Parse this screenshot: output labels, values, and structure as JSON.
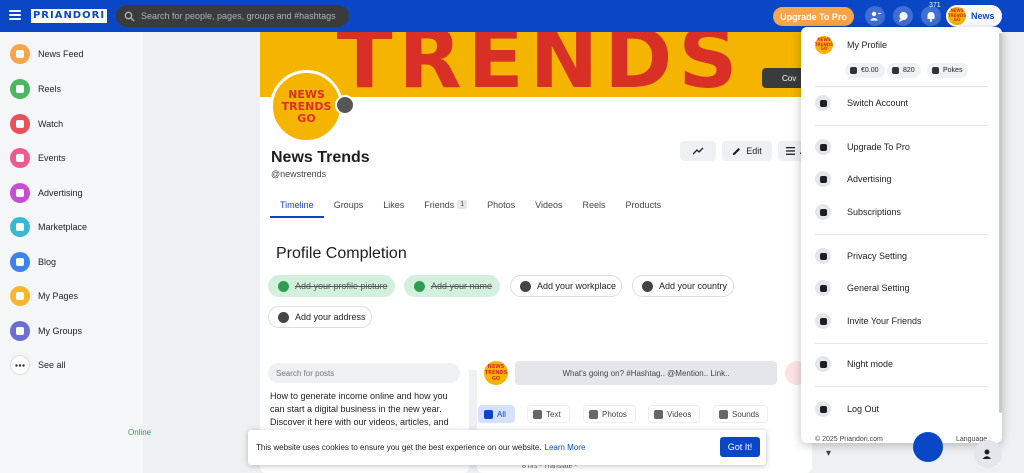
{
  "topbar": {
    "logo_text": "PRIANDORI",
    "search_placeholder": "Search for people, pages, groups and #hashtags",
    "upgrade_label": "Upgrade To Pro",
    "notification_count": "371",
    "user_name": "News"
  },
  "sidebar": {
    "items": [
      {
        "label": "News Feed",
        "color": "#f7a54b"
      },
      {
        "label": "Reels",
        "color": "#4cb663"
      },
      {
        "label": "Watch",
        "color": "#e8505b"
      },
      {
        "label": "Events",
        "color": "#ee5b8c"
      },
      {
        "label": "Advertising",
        "color": "#c44fd4"
      },
      {
        "label": "Marketplace",
        "color": "#37b9d4"
      },
      {
        "label": "Blog",
        "color": "#3c82e8"
      },
      {
        "label": "My Pages",
        "color": "#f7b42c"
      },
      {
        "label": "My Groups",
        "color": "#6b6fd4"
      },
      {
        "label": "See all",
        "color": "#ffffff"
      }
    ]
  },
  "cover": {
    "title_text": "TRENDS",
    "button_label": "Cov"
  },
  "profile": {
    "avatar_line1": "NEWS",
    "avatar_line2": "TRENDS",
    "avatar_line3": "GO",
    "name": "News Trends",
    "handle": "@newstrends",
    "edit_label": "Edit",
    "more_label": "A",
    "tabs": [
      {
        "label": "Timeline"
      },
      {
        "label": "Groups"
      },
      {
        "label": "Likes"
      },
      {
        "label": "Friends",
        "count": "1"
      },
      {
        "label": "Photos"
      },
      {
        "label": "Videos"
      },
      {
        "label": "Reels"
      },
      {
        "label": "Products"
      }
    ]
  },
  "completion": {
    "title": "Profile Completion",
    "items": [
      {
        "label": "Add your profile picture",
        "done": true
      },
      {
        "label": "Add your name",
        "done": true
      },
      {
        "label": "Add your workplace",
        "done": false
      },
      {
        "label": "Add your country",
        "done": false
      },
      {
        "label": "Add your address",
        "done": false
      }
    ]
  },
  "left_card": {
    "search_placeholder": "Search for posts",
    "text": "How to generate income online and how you can start a digital business in the new year. Discover it here with our videos, articles, and tips for",
    "online_label": "Online"
  },
  "composer": {
    "placeholder": "What's going on? #Hashtag.. @Mention.. Link..",
    "tabs": [
      "All",
      "Text",
      "Photos",
      "Videos",
      "Sounds"
    ],
    "post_meta": "8 hrs - Translate -"
  },
  "cookie": {
    "text": "This website uses cookies to ensure you get the best experience on our website.",
    "link": "Learn More",
    "button": "Got It!"
  },
  "menu": {
    "my_profile": "My Profile",
    "wallet": "€0.00",
    "points": "820",
    "pokes": "Pokes",
    "items": [
      "Switch Account",
      "Upgrade To Pro",
      "Advertising",
      "Subscriptions",
      "Privacy Setting",
      "General Setting",
      "Invite Your Friends",
      "Night mode",
      "Log Out"
    ],
    "footer": "© 2025 Priandori.com",
    "language": "Language"
  },
  "colors": {
    "brand": "#0a47c7",
    "cover": "#f4b400",
    "cover_text": "#d93025",
    "upgrade": "#f7a54b"
  }
}
